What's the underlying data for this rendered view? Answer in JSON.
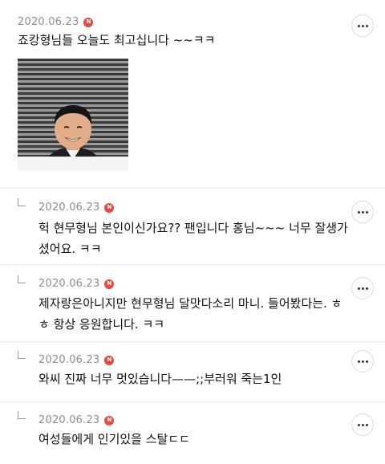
{
  "comments": [
    {
      "date": "2020.06.23",
      "badge": "N",
      "text": "죠캉형님들 오늘도 최고십니다 ~~ㅋㅋ",
      "is_reply": false,
      "has_image": true,
      "image_alt": "smiling man photo"
    },
    {
      "date": "2020.06.23",
      "badge": "N",
      "text_lines": [
        "헉 현무형님 본인이신가요?? 팬입니다 홍님~~~ 너무 잘생가",
        "셨어요. ㅋㅋ"
      ],
      "is_reply": true
    },
    {
      "date": "2020.06.23",
      "badge": "N",
      "text_lines": [
        "제자랑은아니지만 현무형님 달맛다소리 마니. 들어봤다는. ㅎ",
        "ㅎ 항상 응원합니다. ㅋㅋ"
      ],
      "is_reply": true
    },
    {
      "date": "2020.06.23",
      "badge": "N",
      "text": "와씨 진짜 너무 멋있습니다——;;부러워 죽는1인",
      "is_reply": true
    },
    {
      "date": "2020.06.23",
      "badge": "N",
      "text": "여성들에게 인기있을 스탈ㄷㄷ",
      "is_reply": true
    }
  ],
  "icons": {
    "more": "more-horizontal-icon",
    "reply": "reply-corner-icon",
    "new_badge": "new-badge-icon"
  },
  "colors": {
    "badge": "#e8483f",
    "date": "#8e8e8e",
    "divider": "#ebebeb"
  }
}
